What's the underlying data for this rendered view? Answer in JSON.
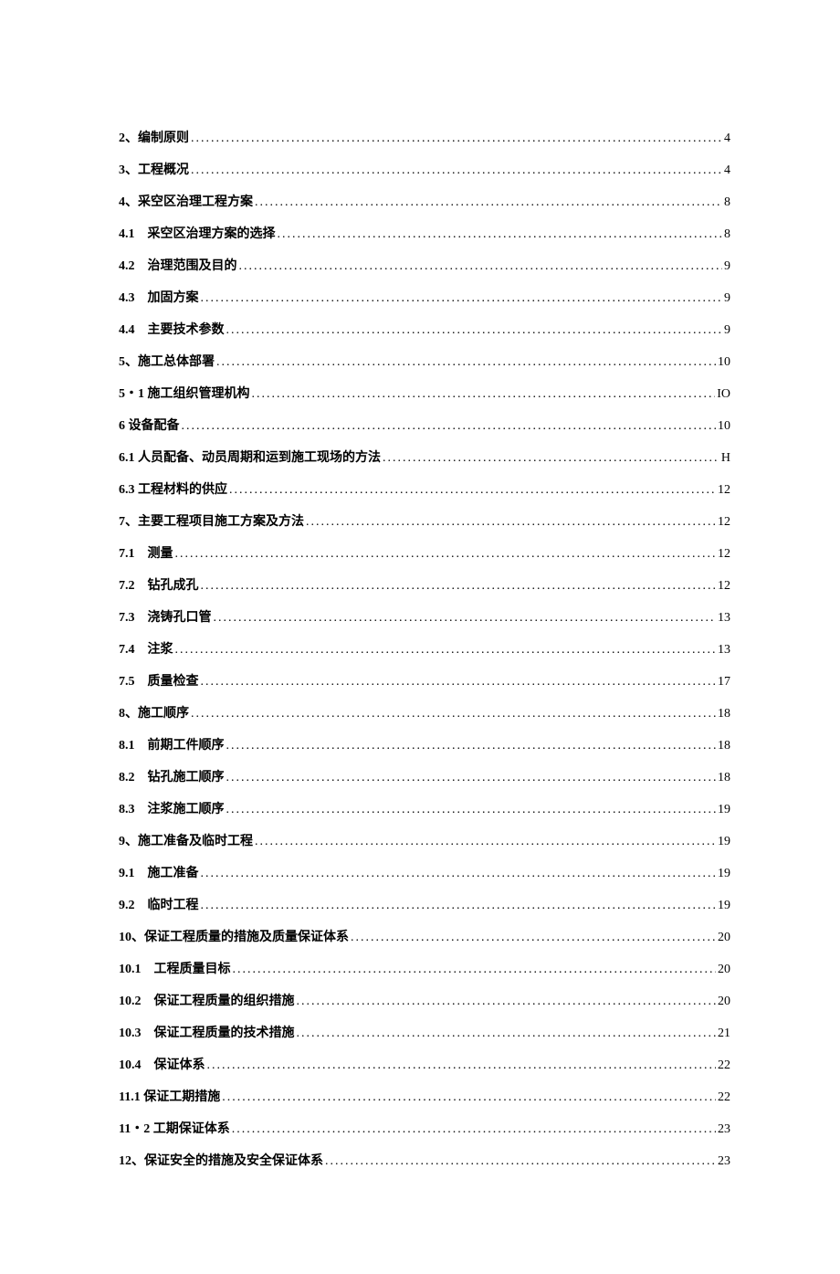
{
  "toc": [
    {
      "label": "2、编制原则",
      "page": "4"
    },
    {
      "label": "3、工程概况",
      "page": "4"
    },
    {
      "label": "4、采空区治理工程方案",
      "page": "8"
    },
    {
      "label": "4.1　采空区治理方案的选择",
      "page": "8"
    },
    {
      "label": "4.2　治理范围及目的",
      "page": "9"
    },
    {
      "label": "4.3　加固方案",
      "page": "9"
    },
    {
      "label": "4.4　主要技术参数",
      "page": "9"
    },
    {
      "label": "5、施工总体部署",
      "page": "10"
    },
    {
      "label": "5・1 施工组织管理机构",
      "page": "IO"
    },
    {
      "label": "6 设备配备",
      "page": "10"
    },
    {
      "label": "6.1 人员配备、动员周期和运到施工现场的方法",
      "page": "H"
    },
    {
      "label": "6.3 工程材料的供应",
      "page": "12"
    },
    {
      "label": "7、主要工程项目施工方案及方法",
      "page": "12"
    },
    {
      "label": "7.1　测量",
      "page": "12"
    },
    {
      "label": "7.2　钻孔成孔",
      "page": "12"
    },
    {
      "label": "7.3　浇铸孔口管",
      "page": "13"
    },
    {
      "label": "7.4　注浆",
      "page": "13"
    },
    {
      "label": "7.5　质量检查",
      "page": "17"
    },
    {
      "label": "8、施工顺序",
      "page": "18"
    },
    {
      "label": "8.1　前期工件顺序",
      "page": "18"
    },
    {
      "label": "8.2　钻孔施工顺序",
      "page": "18"
    },
    {
      "label": "8.3　注浆施工顺序",
      "page": "19"
    },
    {
      "label": "9、施工准备及临时工程",
      "page": "19"
    },
    {
      "label": "9.1　施工准备",
      "page": "19"
    },
    {
      "label": "9.2　临时工程",
      "page": "19"
    },
    {
      "label": "10、保证工程质量的措施及质量保证体系",
      "page": "20"
    },
    {
      "label": "10.1　工程质量目标",
      "page": "20"
    },
    {
      "label": "10.2　保证工程质量的组织措施",
      "page": "20"
    },
    {
      "label": "10.3　保证工程质量的技术措施",
      "page": "21"
    },
    {
      "label": "10.4　保证体系",
      "page": "22"
    },
    {
      "label": "11.1 保证工期措施",
      "page": "22"
    },
    {
      "label": "11・2 工期保证体系",
      "page": "23"
    },
    {
      "label": "12、保证安全的措施及安全保证体系",
      "page": "23"
    }
  ]
}
